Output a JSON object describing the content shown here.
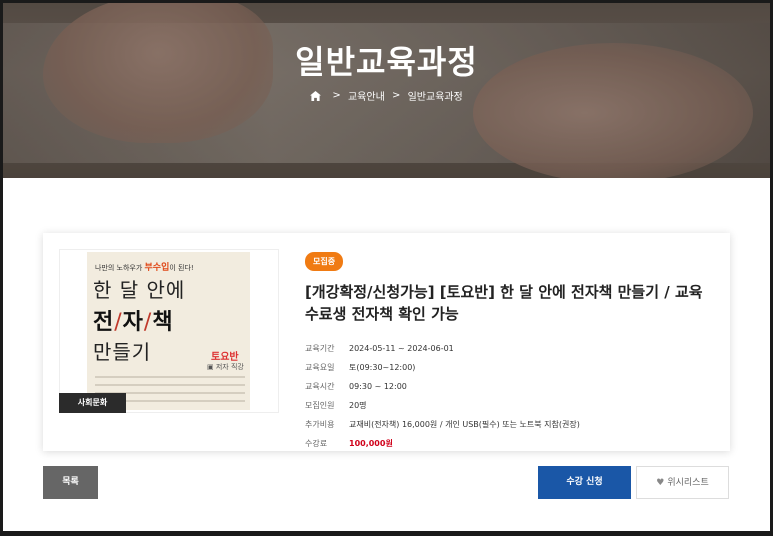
{
  "hero": {
    "title": "일반교육과정",
    "breadcrumb": [
      "교육안내",
      "일반교육과정"
    ],
    "home_icon": "home-icon"
  },
  "course": {
    "status": "모집중",
    "category": "사회문화",
    "title": "[개강확정/신청가능] [토요반] 한 달 안에 전자책 만들기 / 교육수료생 전자책 확인 가능",
    "thumbnail": {
      "tagline_pre": "나만의 노하우가 ",
      "tagline_em": "부수입",
      "tagline_post": "이 된다!",
      "line1": "한 달 안에",
      "line2a": "전",
      "line2b": "자",
      "line2c": "책",
      "line3": "만들기",
      "badge": "토요반",
      "author": "저자 직강"
    },
    "details": [
      {
        "label": "교육기간",
        "value": "2024-05-11 ~ 2024-06-01"
      },
      {
        "label": "교육요일",
        "value": "토(09:30~12:00)"
      },
      {
        "label": "교육시간",
        "value": "09:30 ~ 12:00"
      },
      {
        "label": "모집인원",
        "value": "20명"
      },
      {
        "label": "추가비용",
        "value": "교재비(전자책) 16,000원 / 개인 USB(필수) 또는 노트북 지참(권장)"
      },
      {
        "label": "수강료",
        "value": "100,000원"
      }
    ]
  },
  "buttons": {
    "list": "목록",
    "apply": "수강 신청",
    "wishlist": "위시리스트"
  },
  "colors": {
    "status": "#f07b13",
    "apply": "#1a57a7",
    "price": "#d0021b"
  }
}
